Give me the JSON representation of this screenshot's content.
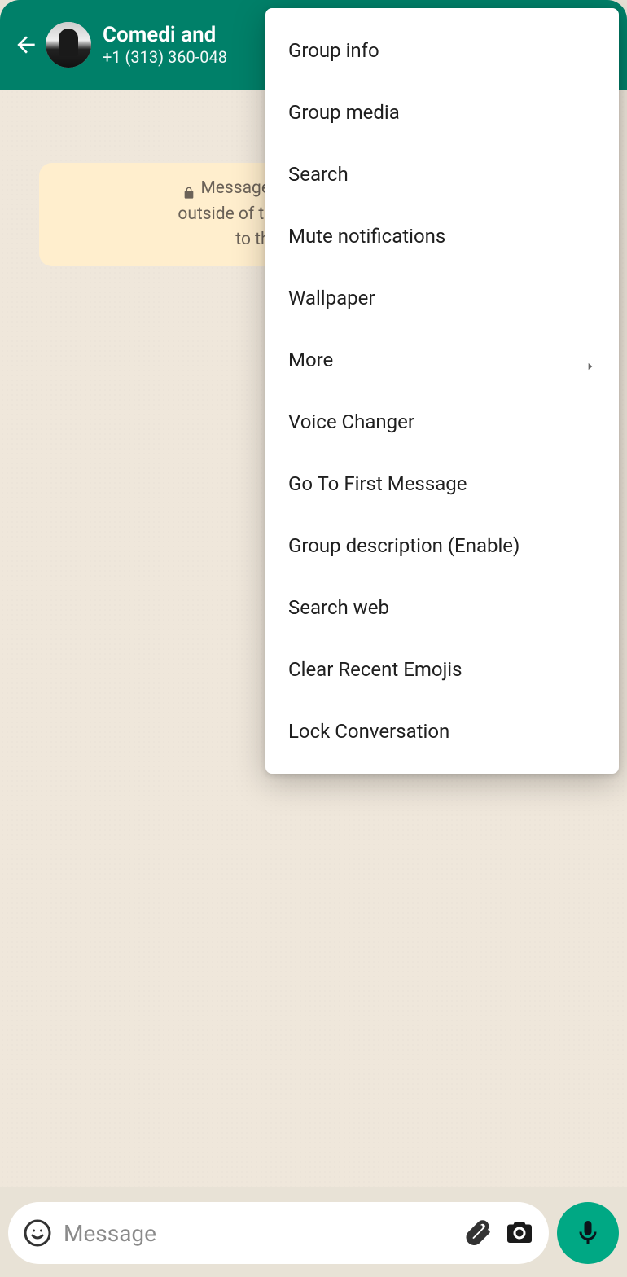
{
  "header": {
    "title": "Comedi and",
    "subtitle": "+1 (313) 360-048"
  },
  "encryption": {
    "line1": "Messages and calls",
    "line2": "outside of this chat, not",
    "line3": "to them."
  },
  "menu": {
    "items": [
      {
        "label": "Group info",
        "arrow": false
      },
      {
        "label": "Group media",
        "arrow": false
      },
      {
        "label": "Search",
        "arrow": false
      },
      {
        "label": "Mute notifications",
        "arrow": false
      },
      {
        "label": "Wallpaper",
        "arrow": false
      },
      {
        "label": "More",
        "arrow": true
      },
      {
        "label": "Voice Changer",
        "arrow": false
      },
      {
        "label": "Go To First Message",
        "arrow": false
      },
      {
        "label": "Group description (Enable)",
        "arrow": false
      },
      {
        "label": "Search web",
        "arrow": false
      },
      {
        "label": "Clear Recent Emojis",
        "arrow": false
      },
      {
        "label": "Lock Conversation",
        "arrow": false
      }
    ]
  },
  "input": {
    "placeholder": "Message"
  }
}
